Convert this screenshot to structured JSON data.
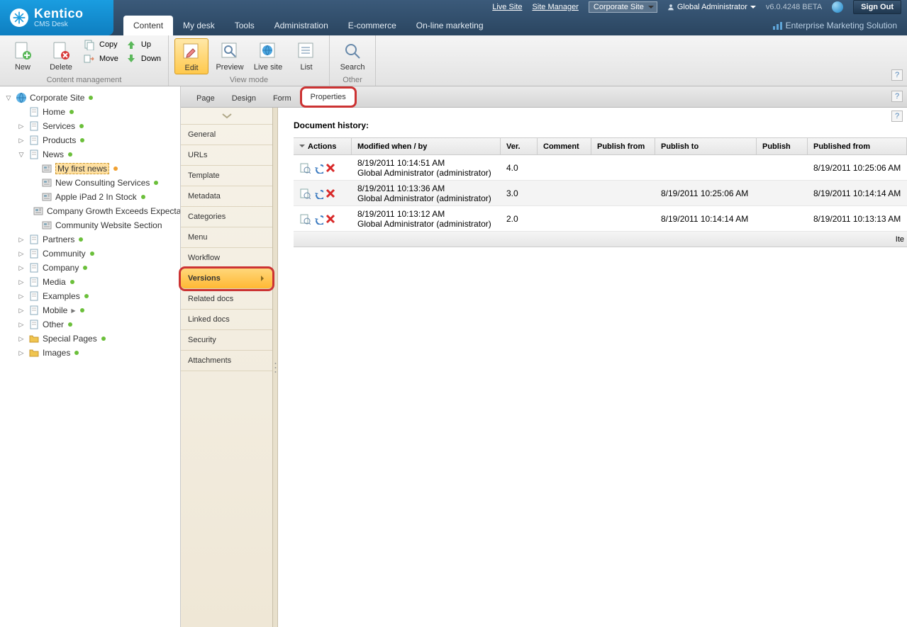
{
  "topbar": {
    "logo_main": "Kentico",
    "logo_sub": "CMS Desk",
    "live_site": "Live Site",
    "site_manager": "Site Manager",
    "site_selector": "Corporate Site",
    "user": "Global Administrator",
    "version": "v6.0.4248 BETA",
    "sign_out": "Sign Out",
    "edition": "Enterprise Marketing Solution"
  },
  "maintabs": [
    "Content",
    "My desk",
    "Tools",
    "Administration",
    "E-commerce",
    "On-line marketing"
  ],
  "maintabs_active": 0,
  "ribbon": {
    "group1_label": "Content management",
    "new": "New",
    "delete": "Delete",
    "copy": "Copy",
    "move": "Move",
    "up": "Up",
    "down": "Down",
    "group2_label": "View mode",
    "edit": "Edit",
    "preview": "Preview",
    "live_site": "Live site",
    "list": "List",
    "group3_label": "Other",
    "search": "Search"
  },
  "tree": [
    {
      "depth": 0,
      "toggle": "open",
      "icon": "globe",
      "label": "Corporate Site",
      "dot": "green"
    },
    {
      "depth": 1,
      "toggle": "none",
      "icon": "page",
      "label": "Home",
      "dot": "green"
    },
    {
      "depth": 1,
      "toggle": "closed",
      "icon": "page",
      "label": "Services",
      "dot": "green"
    },
    {
      "depth": 1,
      "toggle": "closed",
      "icon": "page",
      "label": "Products",
      "dot": "green"
    },
    {
      "depth": 1,
      "toggle": "open",
      "icon": "page",
      "label": "News",
      "dot": "green"
    },
    {
      "depth": 2,
      "toggle": "none",
      "icon": "news",
      "label": "My first news",
      "dot": "orange",
      "selected": true
    },
    {
      "depth": 2,
      "toggle": "none",
      "icon": "news",
      "label": "New Consulting Services",
      "dot": "green"
    },
    {
      "depth": 2,
      "toggle": "none",
      "icon": "news",
      "label": "Apple iPad 2 In Stock",
      "dot": "green"
    },
    {
      "depth": 2,
      "toggle": "none",
      "icon": "news",
      "label": "Company Growth Exceeds Expectations"
    },
    {
      "depth": 2,
      "toggle": "none",
      "icon": "news",
      "label": "Community Website Section"
    },
    {
      "depth": 1,
      "toggle": "closed",
      "icon": "page",
      "label": "Partners",
      "dot": "green"
    },
    {
      "depth": 1,
      "toggle": "closed",
      "icon": "page",
      "label": "Community",
      "dot": "green"
    },
    {
      "depth": 1,
      "toggle": "closed",
      "icon": "page",
      "label": "Company",
      "dot": "green"
    },
    {
      "depth": 1,
      "toggle": "closed",
      "icon": "page",
      "label": "Media",
      "dot": "green"
    },
    {
      "depth": 1,
      "toggle": "closed",
      "icon": "page",
      "label": "Examples",
      "dot": "green"
    },
    {
      "depth": 1,
      "toggle": "closed",
      "icon": "page",
      "label": "Mobile",
      "arrow": true,
      "dot": "green"
    },
    {
      "depth": 1,
      "toggle": "closed",
      "icon": "page",
      "label": "Other",
      "dot": "green"
    },
    {
      "depth": 1,
      "toggle": "closed",
      "icon": "folder",
      "label": "Special Pages",
      "dot": "green"
    },
    {
      "depth": 1,
      "toggle": "closed",
      "icon": "folder",
      "label": "Images",
      "dot": "green"
    }
  ],
  "subtabs": [
    "Page",
    "Design",
    "Form",
    "Properties"
  ],
  "subtabs_active": 3,
  "vmenu": [
    "General",
    "URLs",
    "Template",
    "Metadata",
    "Categories",
    "Menu",
    "Workflow",
    "Versions",
    "Related docs",
    "Linked docs",
    "Security",
    "Attachments"
  ],
  "vmenu_selected": 7,
  "panel": {
    "title": "Document history:",
    "columns": [
      "Actions",
      "Modified when / by",
      "Ver.",
      "Comment",
      "Publish from",
      "Publish to",
      "Publish",
      "Published from"
    ],
    "rows": [
      {
        "when": "8/19/2011 10:14:51 AM",
        "by": "Global Administrator (administrator)",
        "ver": "4.0",
        "comment": "",
        "pubfrom": "",
        "pubto": "",
        "publish": "",
        "pubfromval": "8/19/2011 10:25:06 AM"
      },
      {
        "when": "8/19/2011 10:13:36 AM",
        "by": "Global Administrator (administrator)",
        "ver": "3.0",
        "comment": "",
        "pubfrom": "",
        "pubto": "8/19/2011 10:25:06 AM",
        "publish": "",
        "pubfromval": "8/19/2011 10:14:14 AM"
      },
      {
        "when": "8/19/2011 10:13:12 AM",
        "by": "Global Administrator (administrator)",
        "ver": "2.0",
        "comment": "",
        "pubfrom": "",
        "pubto": "8/19/2011 10:14:14 AM",
        "publish": "",
        "pubfromval": "8/19/2011 10:13:13 AM"
      }
    ],
    "footer": "Ite"
  }
}
